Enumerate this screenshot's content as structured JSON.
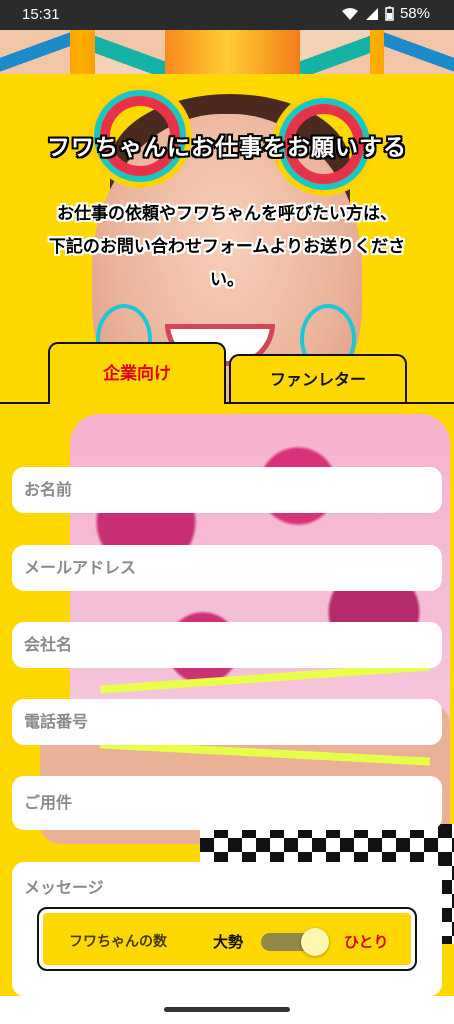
{
  "status_bar": {
    "time": "15:31",
    "battery": "58%"
  },
  "hero": {
    "title": "フワちゃんにお仕事をお願いする",
    "description_line1": "お仕事の依頼やフワちゃんを呼びたい方は、",
    "description_line2": "下記のお問い合わせフォームよりお送りくださ",
    "description_line3": "い。"
  },
  "tabs": [
    {
      "label": "企業向け",
      "active": true
    },
    {
      "label": "ファンレター",
      "active": false
    }
  ],
  "form": {
    "name_placeholder": "お名前",
    "email_placeholder": "メールアドレス",
    "company_placeholder": "会社名",
    "phone_placeholder": "電話番号",
    "subject_placeholder": "ご用件",
    "message_placeholder": "メッセージ"
  },
  "counter": {
    "label": "フワちゃんの数",
    "left_option": "大勢",
    "right_option": "ひとり",
    "selected": "ひとり",
    "level": 1
  },
  "colors": {
    "background": "#ffd800",
    "accent_red": "#e0001a"
  }
}
